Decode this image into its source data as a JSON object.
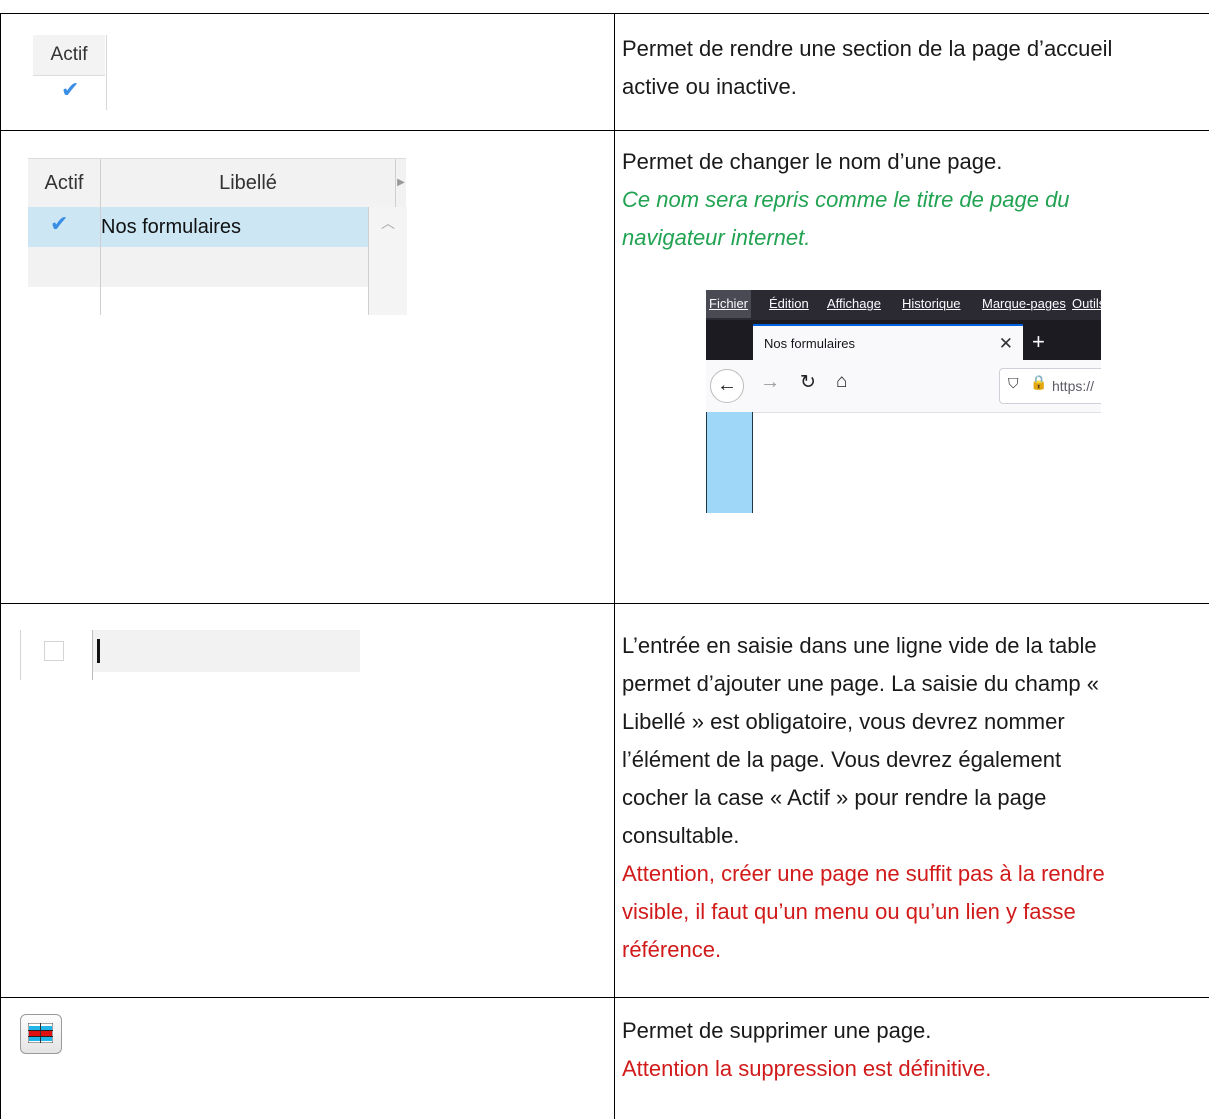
{
  "rows": [
    {
      "left": {
        "actif_header": "Actif"
      },
      "right": {
        "text": "Permet de rendre une section de la page d’accueil active ou inactive."
      }
    },
    {
      "left": {
        "columns": [
          "Actif",
          "Libellé"
        ],
        "row_value": "Nos formulaires"
      },
      "right": {
        "text": "Permet de changer le nom d’une page.",
        "note": "Ce nom sera repris comme le titre de page du navigateur internet.",
        "browser": {
          "menu": [
            "Fichier",
            "Édition",
            "Affichage",
            "Historique",
            "Marque-pages",
            "Outils"
          ],
          "tab_title": "Nos formulaires",
          "url": "https://"
        }
      }
    },
    {
      "right": {
        "lines": [
          "L’entrée en saisie dans une ligne vide de la table",
          "permet d’ajouter une page. La saisie du champ «",
          "Libellé » est obligatoire, vous devrez nommer",
          "l’élément de la page. Vous devrez également",
          "cocher la case « Actif » pour rendre la page",
          "consultable."
        ],
        "warning_lines": [
          "Attention, créer une page ne suffit pas à la rendre",
          "visible, il faut qu’un menu ou qu’un lien y fasse",
          "référence."
        ]
      }
    },
    {
      "left": {
        "icon": "delete-row-icon"
      },
      "right": {
        "text": "Permet de supprimer une page.",
        "warning": "Attention la suppression est définitive."
      }
    }
  ],
  "colors": {
    "green_note": "#21a352",
    "red_warning": "#d11a1a",
    "check_blue": "#3a8ee6"
  }
}
